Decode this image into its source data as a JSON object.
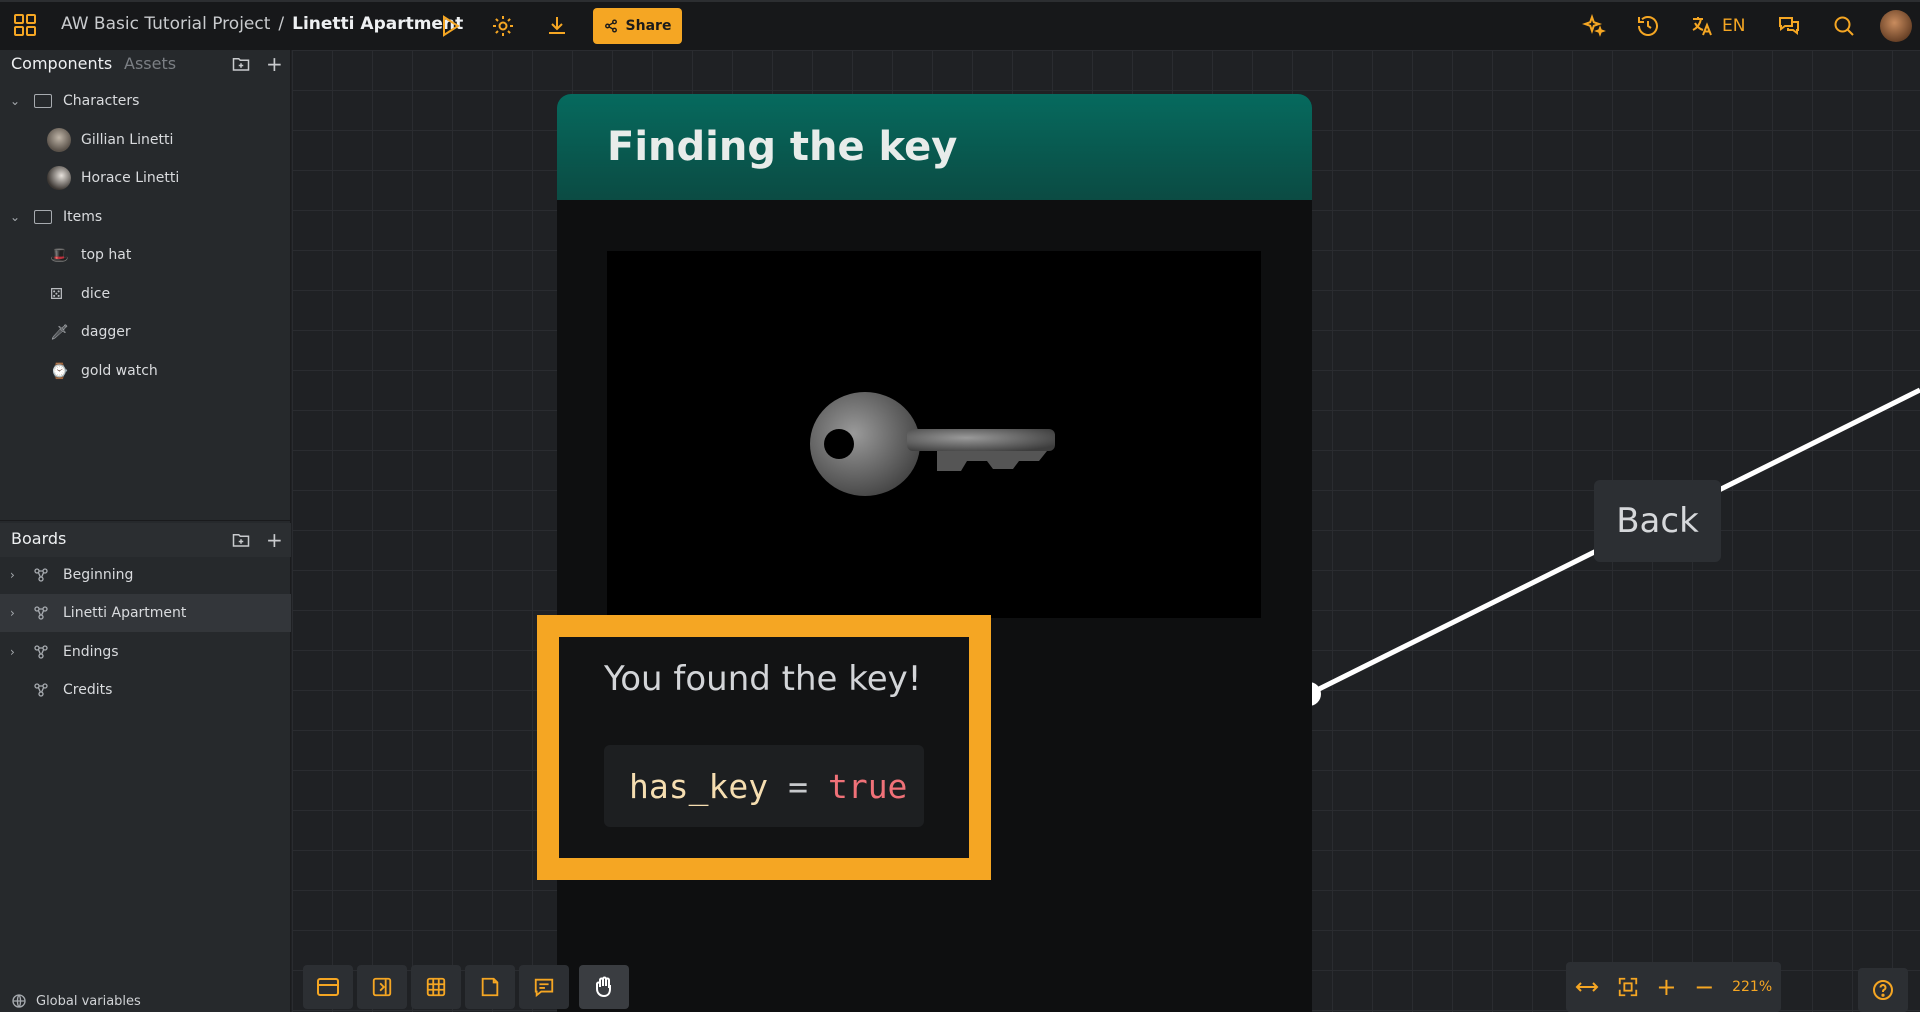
{
  "topbar": {
    "project": "AW Basic Tutorial Project",
    "separator": "/",
    "board": "Linetti Apartment",
    "share_label": "Share",
    "language": "EN"
  },
  "sidebar": {
    "tab_components": "Components",
    "tab_assets": "Assets",
    "folders": [
      {
        "label": "Characters",
        "items": [
          "Gillian Linetti",
          "Horace Linetti"
        ]
      },
      {
        "label": "Items",
        "items": [
          "top hat",
          "dice",
          "dagger",
          "gold watch"
        ]
      }
    ],
    "boards_title": "Boards",
    "boards": [
      "Beginning",
      "Linetti Apartment",
      "Endings",
      "Credits"
    ],
    "global_variables": "Global variables"
  },
  "canvas": {
    "card_title": "Finding the key",
    "text": "You found the key!",
    "code_var": "has_key",
    "code_op": "=",
    "code_val": "true",
    "back_label": "Back",
    "zoom": "221%"
  },
  "colors": {
    "accent": "#f5a623",
    "card_header": "#066a5e"
  }
}
